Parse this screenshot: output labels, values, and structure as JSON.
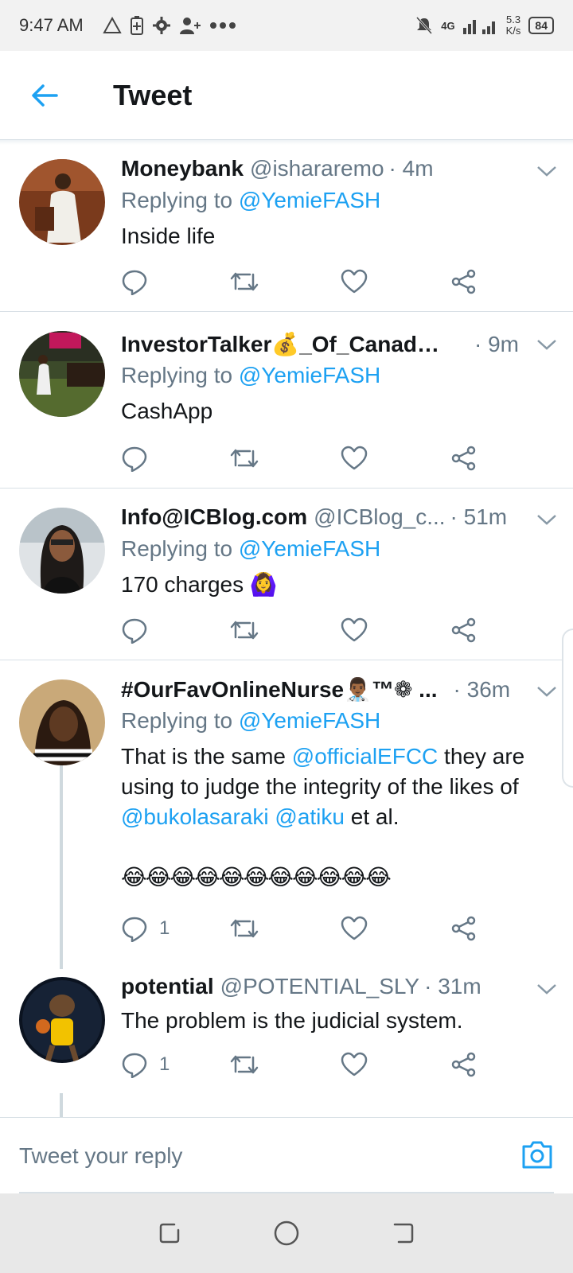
{
  "status_bar": {
    "time": "9:47 AM",
    "network": "4G",
    "speed_value": "5.3",
    "speed_unit": "K/s",
    "battery": "84"
  },
  "header": {
    "title": "Tweet"
  },
  "tweets": [
    {
      "name": "Moneybank",
      "handle": "@ishararemo",
      "time": "· 4m",
      "replying_prefix": "Replying to ",
      "replying_to": "@YemieFASH",
      "text": "Inside life",
      "reply_count": ""
    },
    {
      "name": "InvestorTalker💰_Of_Canada...",
      "handle": "",
      "time": "· 9m",
      "replying_prefix": "Replying to ",
      "replying_to": "@YemieFASH",
      "text": "CashApp",
      "reply_count": ""
    },
    {
      "name": "Info@ICBlog.com",
      "handle": "@ICBlog_c...",
      "time": "· 51m",
      "replying_prefix": "Replying to ",
      "replying_to": "@YemieFASH",
      "text": "170 charges 🙆‍♀️",
      "reply_count": ""
    },
    {
      "name": "#OurFavOnlineNurse👨🏾‍⚕️™❁ ...",
      "handle": "",
      "time": "· 36m",
      "replying_prefix": "Replying to ",
      "replying_to": "@YemieFASH",
      "text_parts": {
        "t1": "That is the same ",
        "m1": "@officialEFCC",
        "t2": " they are using to judge the integrity of the likes of ",
        "m2": "@bukolasaraki",
        "t3": " ",
        "m3": "@atiku",
        "t4": " et al.",
        "emojis": "😂😂😂😂😂😂😂😂😂😂😂"
      },
      "reply_count": "1"
    },
    {
      "name": "potential",
      "handle": "@POTENTIAL_SLY",
      "time": "· 31m",
      "text": "The problem is the judicial system.",
      "reply_count": "1"
    }
  ],
  "reply_bar": {
    "placeholder": "Tweet your reply"
  },
  "icons": {
    "back": "arrow-left-icon",
    "chevron": "chevron-down-icon",
    "reply": "reply-icon",
    "retweet": "retweet-icon",
    "like": "heart-icon",
    "share": "share-icon",
    "camera": "camera-icon"
  },
  "colors": {
    "accent": "#1da1f2",
    "secondary_text": "#657786",
    "divider": "#d8e0e6"
  }
}
